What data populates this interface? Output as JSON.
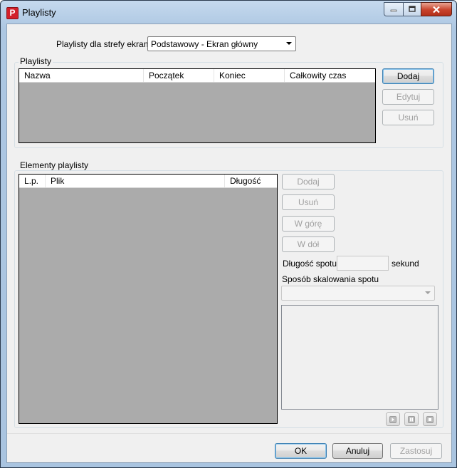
{
  "window": {
    "title": "Playlisty",
    "app_icon_letter": "P"
  },
  "screen_zone": {
    "label": "Playlisty dla strefy ekranu",
    "selected": "Podstawowy - Ekran główny"
  },
  "playlists_group": {
    "title": "Playlisty",
    "columns": [
      "Nazwa",
      "Początek",
      "Koniec",
      "Całkowity czas"
    ],
    "buttons": {
      "add": "Dodaj",
      "edit": "Edytuj",
      "remove": "Usuń"
    }
  },
  "elements_group": {
    "title": "Elementy playlisty",
    "columns": [
      "L.p.",
      "Plik",
      "Długość"
    ],
    "buttons": {
      "add": "Dodaj",
      "remove": "Usuń",
      "up": "W górę",
      "down": "W dół"
    },
    "spot_length_label": "Długość spotu",
    "spot_length_value": "",
    "seconds_label": "sekund",
    "scaling_label": "Sposób skalowania spotu",
    "scaling_selected": ""
  },
  "media_controls": [
    "play-icon",
    "pause-icon",
    "stop-icon"
  ],
  "footer": {
    "ok": "OK",
    "cancel": "Anuluj",
    "apply": "Zastosuj"
  },
  "colors": {
    "list_background": "#ababab",
    "dialog_background": "#f0f0f0",
    "close_button": "#c8432b"
  }
}
